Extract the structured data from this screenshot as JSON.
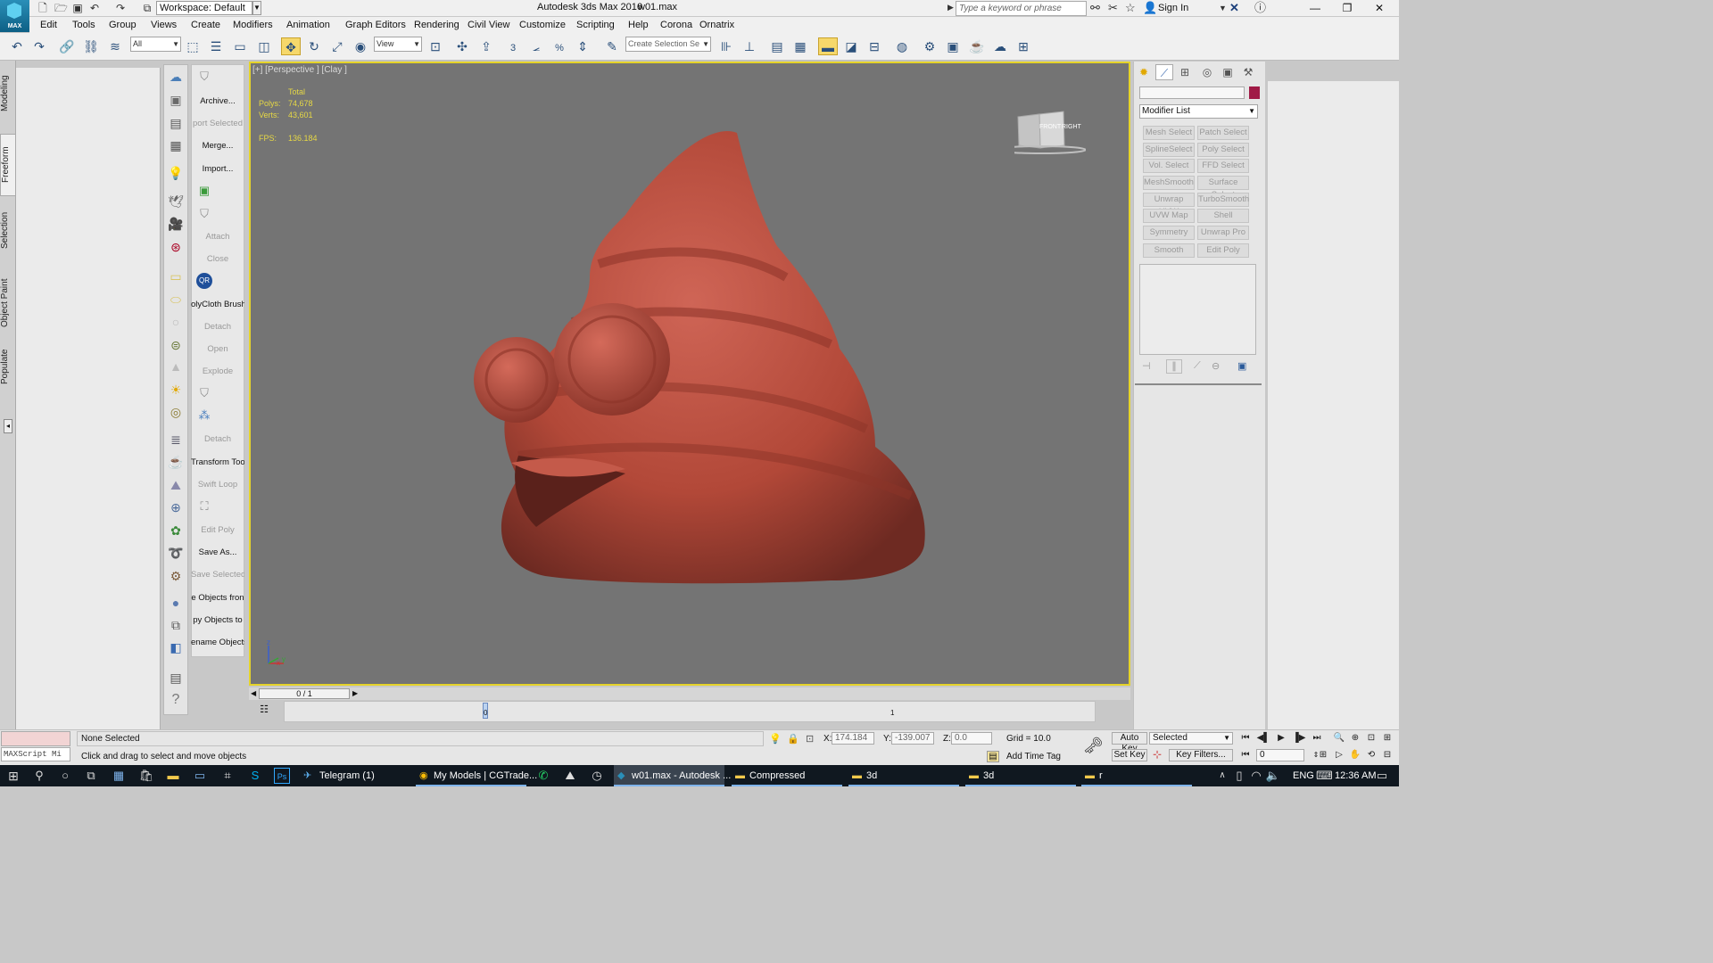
{
  "title_bar": {
    "logo_text": "MAX",
    "workspace": "Workspace: Default",
    "app_title": "Autodesk 3ds Max 2016",
    "file_name": "w01.max",
    "search_placeholder": "Type a keyword or phrase",
    "sign_in": "Sign In"
  },
  "menu": [
    "Edit",
    "Tools",
    "Group",
    "Views",
    "Create",
    "Modifiers",
    "Animation",
    "Graph Editors",
    "Rendering",
    "Civil View",
    "Customize",
    "Scripting",
    "Help",
    "Corona",
    "Ornatrix"
  ],
  "toolbar": {
    "filter_value": "All",
    "ref_coord_value": "View",
    "selection_set_placeholder": "Create Selection Se",
    "snap_labels": [
      "3",
      "%"
    ]
  },
  "left_tabs": [
    "Modeling",
    "Freeform",
    "Selection",
    "Object Paint",
    "Populate"
  ],
  "script_panel": {
    "items": [
      {
        "label": "Archive...",
        "enabled": true
      },
      {
        "label": "port Selected",
        "enabled": false
      },
      {
        "label": "Merge...",
        "enabled": true
      },
      {
        "label": "Import...",
        "enabled": true
      },
      {
        "label": "Attach",
        "enabled": false
      },
      {
        "label": "Close",
        "enabled": false
      },
      {
        "label": "olyCloth Brush",
        "enabled": true
      },
      {
        "label": "Detach",
        "enabled": false
      },
      {
        "label": "Open",
        "enabled": false
      },
      {
        "label": "Explode",
        "enabled": false
      },
      {
        "label": "Detach",
        "enabled": false
      },
      {
        "label": "Transform Tool",
        "enabled": true
      },
      {
        "label": "Swift Loop",
        "enabled": false
      },
      {
        "label": "Edit Poly",
        "enabled": false
      },
      {
        "label": "Save As...",
        "enabled": true
      },
      {
        "label": "Save Selected",
        "enabled": false
      },
      {
        "label": "e Objects fron",
        "enabled": true
      },
      {
        "label": "py Objects to",
        "enabled": true
      },
      {
        "label": "ename Objects",
        "enabled": true
      }
    ]
  },
  "viewport": {
    "label": "[+] [Perspective ] [Clay ]",
    "stats_header": "Total",
    "polys_label": "Polys:",
    "polys_value": "74,678",
    "verts_label": "Verts:",
    "verts_value": "43,601",
    "fps_label": "FPS:",
    "fps_value": "136.184",
    "viewcube_front": "FRONT",
    "viewcube_right": "RIGHT",
    "axis_z": "z",
    "axis_x": "x",
    "axis_y": "y",
    "model_color": "#b84a3e"
  },
  "timeline": {
    "frame_counter": "0 / 1",
    "track_marks": [
      "0",
      "1"
    ]
  },
  "command_panel": {
    "modifier_list": "Modifier List",
    "buttons": [
      "Mesh Select",
      "Patch Select",
      "SplineSelect",
      "Poly Select",
      "Vol. Select",
      "FFD Select",
      "MeshSmooth",
      "Surface Select",
      "Unwrap UVW",
      "TurboSmooth",
      "UVW Map",
      "Shell",
      "Symmetry",
      "Unwrap Pro",
      "Smooth",
      "Edit Poly"
    ],
    "object_color": "#a01a46"
  },
  "status_bar": {
    "maxscript_label": "MAXScript Mi",
    "selection_status": "None Selected",
    "prompt": "Click and drag to select and move objects",
    "x_label": "X:",
    "x_value": "174.184",
    "y_label": "Y:",
    "y_value": "-139.007",
    "z_label": "Z:",
    "z_value": "0.0",
    "grid": "Grid = 10.0",
    "add_time_tag": "Add Time Tag",
    "auto_key": "Auto Key",
    "set_key": "Set Key",
    "selected_value": "Selected",
    "key_filters": "Key Filters...",
    "current_frame": "0"
  },
  "taskbar": {
    "items": [
      "Telegram (1)",
      "My Models | CGTrade...",
      "w01.max - Autodesk ...",
      "Compressed",
      "3d",
      "3d",
      "r"
    ],
    "language": "ENG",
    "time": "12:36 AM"
  }
}
